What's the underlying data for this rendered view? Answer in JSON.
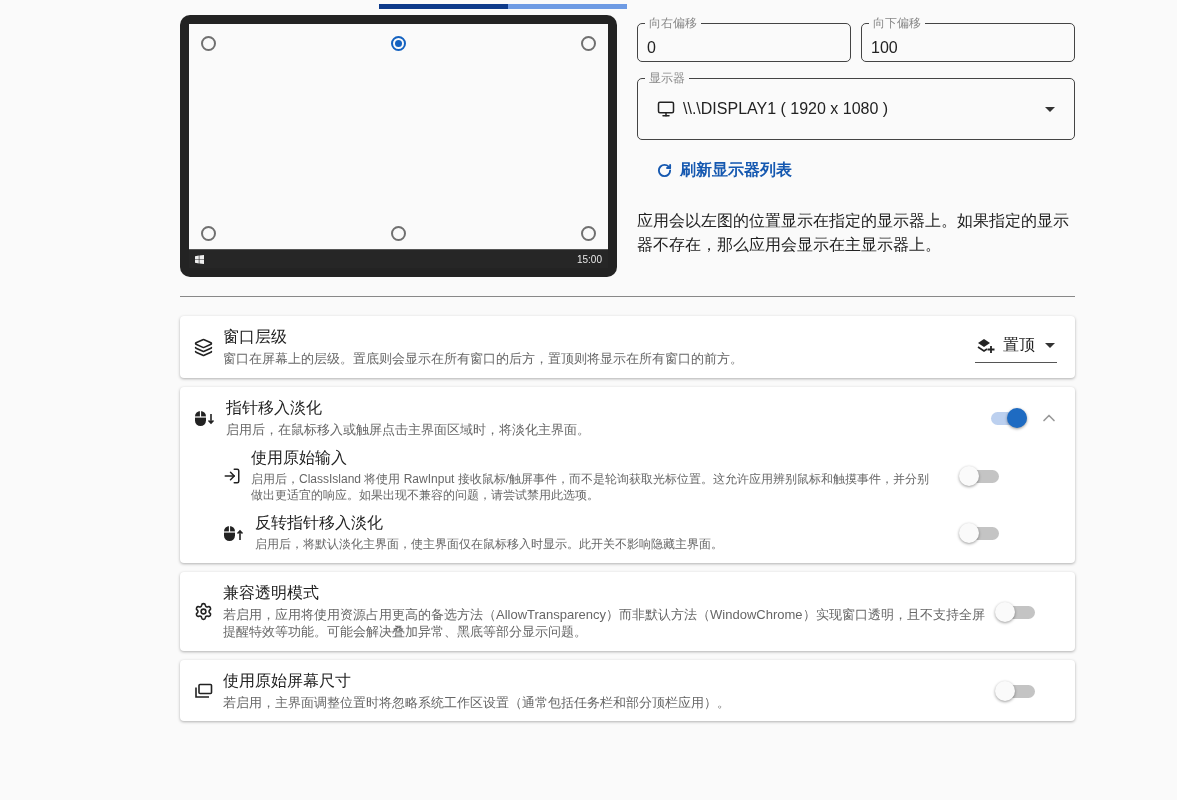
{
  "progress": {
    "level": 0.52
  },
  "preview": {
    "positions": [
      {
        "selected": false
      },
      {
        "selected": true
      },
      {
        "selected": false
      },
      {
        "selected": false
      },
      {
        "selected": false
      },
      {
        "selected": false
      }
    ],
    "clock": "15:00"
  },
  "offsets": [
    {
      "label": "向右偏移",
      "value": "0"
    },
    {
      "label": "向下偏移",
      "value": "100"
    }
  ],
  "display_select": {
    "label": "显示器",
    "value": "\\\\.\\DISPLAY1 ( 1920 x 1080 )"
  },
  "refresh_link": "刷新显示器列表",
  "note": "应用会以左图的位置显示在指定的显示器上。如果指定的显示器不存在，那么应用会显示在主显示器上。",
  "cards": [
    {
      "kind": "select",
      "title": "窗口层级",
      "description": "窗口在屏幕上的层级。置底则会显示在所有窗口的后方，置顶则将显示在所有窗口的前方。",
      "value": "置顶"
    },
    {
      "kind": "toggle",
      "title": "指针移入淡化",
      "description": "启用后，在鼠标移入或触屏点击主界面区域时，将淡化主界面。",
      "on": true,
      "expanded": true,
      "children": [
        {
          "title": "使用原始输入",
          "description": "启用后，ClassIsland 将使用 RawInput 接收鼠标/触屏事件，而不是轮询获取光标位置。这允许应用辨别鼠标和触摸事件，并分别做出更适宜的响应。如果出现不兼容的问题，请尝试禁用此选项。",
          "on": false
        },
        {
          "title": "反转指针移入淡化",
          "description": "启用后，将默认淡化主界面，使主界面仅在鼠标移入时显示。此开关不影响隐藏主界面。",
          "on": false
        }
      ]
    },
    {
      "kind": "toggle",
      "title": "兼容透明模式",
      "description": "若启用，应用将使用资源占用更高的备选方法（AllowTransparency）而非默认方法（WindowChrome）实现窗口透明，且不支持全屏提醒特效等功能。可能会解决叠加异常、黑底等部分显示问题。",
      "on": false
    },
    {
      "kind": "toggle",
      "title": "使用原始屏幕尺寸",
      "description": "若启用，主界面调整位置时将忽略系统工作区设置（通常包括任务栏和部分顶栏应用）。",
      "on": false
    }
  ]
}
